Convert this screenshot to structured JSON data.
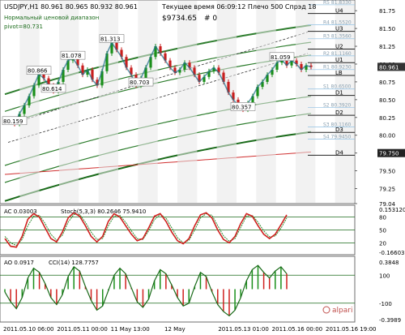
{
  "chart_data": {
    "type": "line",
    "title": "USDJPY,H1  80.961 80.965 80.932 80.961",
    "subtitle_lines": [
      "Нормальный ценовой диапазон",
      "pivot=80.731"
    ],
    "server_info": {
      "line1": "Текущее время 06:09:12 Плечо 500 Спрэд 18",
      "line2": "$9734.65",
      "line3": "# 0"
    },
    "price_axis": {
      "ylim": [
        79.04,
        81.9
      ],
      "ticks": [
        81.75,
        81.5,
        81.25,
        81.0,
        80.75,
        80.5,
        80.25,
        80.0,
        79.75,
        79.5,
        79.25,
        79.04
      ],
      "tick_labels": [
        "81.75",
        "81.50",
        "81.25",
        "81.00",
        "80.75",
        "80.50",
        "80.25",
        "80.00",
        "79.75",
        "79.50",
        "79.25",
        "79.04"
      ],
      "current_price": 80.961,
      "current_price_label": "80.961",
      "highlight_price": 79.75,
      "highlight_label": "79.750"
    },
    "pivot_levels": [
      {
        "name": "R5 81.8330",
        "value": 81.833
      },
      {
        "name": "U4",
        "value": 81.71
      },
      {
        "name": "R4 81.5520",
        "value": 81.552
      },
      {
        "name": "U3",
        "value": 81.46
      },
      {
        "name": "R3 81.3560",
        "value": 81.356
      },
      {
        "name": "U2",
        "value": 81.21
      },
      {
        "name": "R2 81.1160",
        "value": 81.116
      },
      {
        "name": "U1",
        "value": 81.02
      },
      {
        "name": "R1 80.9230",
        "value": 80.923
      },
      {
        "name": "LB",
        "value": 80.84
      },
      {
        "name": "S1 80.6500",
        "value": 80.65
      },
      {
        "name": "D1",
        "value": 80.56
      },
      {
        "name": "S2 80.3920",
        "value": 80.392
      },
      {
        "name": "D2",
        "value": 80.28
      },
      {
        "name": "S3 80.1160",
        "value": 80.116
      },
      {
        "name": "D3",
        "value": 80.04
      },
      {
        "name": "S4 79.9450",
        "value": 79.945
      },
      {
        "name": "D4",
        "value": 79.72
      }
    ],
    "price_labels": [
      "80.866",
      "81.078",
      "81.313",
      "80.159",
      "80.614",
      "80.703",
      "80.357",
      "81.059"
    ],
    "price_series": [
      80.22,
      80.18,
      80.16,
      80.3,
      80.42,
      80.55,
      80.7,
      80.86,
      80.8,
      80.7,
      80.62,
      80.75,
      80.92,
      81.05,
      81.08,
      80.98,
      80.85,
      80.92,
      80.78,
      80.7,
      80.9,
      81.15,
      81.3,
      81.2,
      81.1,
      80.95,
      80.85,
      80.7,
      80.8,
      80.95,
      81.1,
      81.25,
      81.15,
      81.05,
      80.95,
      80.88,
      80.92,
      81.02,
      80.95,
      80.85,
      80.75,
      80.82,
      80.9,
      80.95,
      80.88,
      80.75,
      80.6,
      80.5,
      80.42,
      80.36,
      80.45,
      80.55,
      80.68,
      80.75,
      80.85,
      80.92,
      81.02,
      81.06,
      80.98,
      81.05,
      81.0,
      80.92,
      80.98,
      80.96
    ],
    "ac_panel": {
      "label": "AC 0.03003",
      "stoch_label": "Stoch(5,3,3) 80.2646 75.9410",
      "ylim": [
        -0.166,
        0.153
      ],
      "tick_labels": [
        "0.153120",
        "80",
        "50",
        "20",
        "-0.166030"
      ],
      "stoch_main": [
        30,
        12,
        10,
        35,
        75,
        88,
        80,
        55,
        30,
        22,
        45,
        78,
        90,
        82,
        60,
        35,
        22,
        35,
        70,
        88,
        80,
        60,
        40,
        25,
        30,
        55,
        82,
        88,
        70,
        45,
        25,
        18,
        30,
        60,
        85,
        90,
        78,
        50,
        28,
        20,
        35,
        65,
        88,
        82,
        60,
        40,
        30,
        40,
        62,
        85
      ],
      "stoch_signal": [
        35,
        20,
        14,
        28,
        60,
        82,
        84,
        65,
        40,
        26,
        38,
        68,
        86,
        86,
        68,
        45,
        28,
        30,
        60,
        82,
        84,
        68,
        48,
        30,
        28,
        48,
        74,
        86,
        78,
        55,
        32,
        20,
        26,
        50,
        78,
        88,
        84,
        60,
        36,
        24,
        30,
        56,
        82,
        84,
        68,
        48,
        34,
        36,
        54,
        78
      ]
    },
    "ao_panel": {
      "label": "AO 0.0917",
      "cci_label": "CCI(14) 128.7757",
      "ylim": [
        -0.3989,
        0.3848
      ],
      "tick_labels": [
        "0.3848",
        "100",
        "-100",
        "-0.3989"
      ],
      "cci": [
        -20,
        -90,
        -140,
        -60,
        80,
        150,
        120,
        40,
        -60,
        -110,
        -40,
        90,
        160,
        130,
        20,
        -80,
        -150,
        -120,
        -10,
        100,
        150,
        110,
        10,
        -90,
        -130,
        -70,
        60,
        140,
        110,
        30,
        -60,
        -120,
        -100,
        20,
        120,
        90,
        -20,
        -110,
        -160,
        -190,
        -150,
        -60,
        60,
        140,
        170,
        120,
        80,
        130,
        160,
        110
      ]
    },
    "x_labels": [
      "2011.05.10 06:00",
      "2011.05.11 00:00",
      "11 May 13:00",
      "12 May",
      "2011.05.13 01:00",
      "2011.05.16 00:00",
      "2011.05.16 19:00"
    ],
    "watermark": "alpari"
  }
}
